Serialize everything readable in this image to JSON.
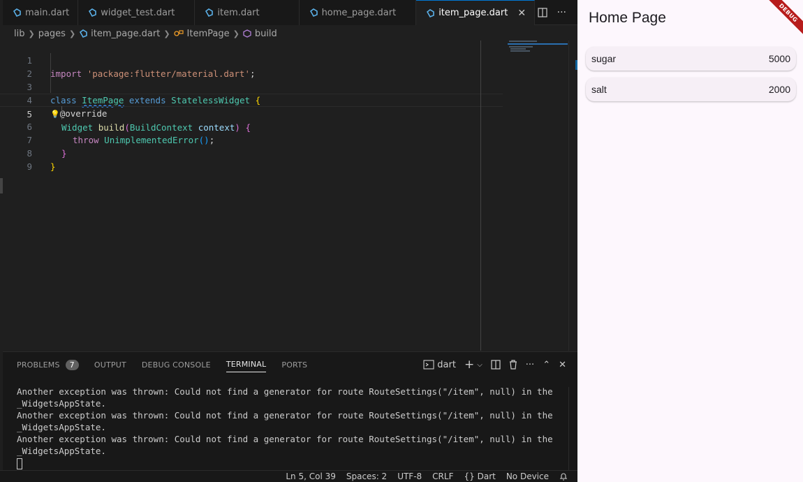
{
  "tabs": [
    {
      "label": "main.dart"
    },
    {
      "label": "widget_test.dart"
    },
    {
      "label": "item.dart"
    },
    {
      "label": "home_page.dart"
    },
    {
      "label": "item_page.dart",
      "active": true
    }
  ],
  "breadcrumb": [
    "lib",
    "pages",
    "item_page.dart",
    "ItemPage",
    "build"
  ],
  "code": {
    "line_numbers": [
      "1",
      "2",
      "3",
      "4",
      "5",
      "6",
      "7",
      "8",
      "9"
    ],
    "l1": {
      "kw": "import",
      "str": "'package:flutter/material.dart'",
      "end": ";"
    },
    "l3": {
      "kw": "class",
      "name": "ItemPage",
      "kw2": "extends",
      "base": "StatelessWidget",
      "brace": "{"
    },
    "l4": {
      "bulb": "💡",
      "annotation": "@override"
    },
    "l5": {
      "type": "Widget",
      "fn": "build",
      "open": "(",
      "ptype": "BuildContext",
      "pname": "context",
      "close": ")",
      "brace": "{"
    },
    "l6": {
      "kw": "throw",
      "cls": "UnimplementedError",
      "call": "()",
      "end": ";"
    },
    "l7": {
      "brace": "}"
    },
    "l8": {
      "brace": "}"
    }
  },
  "panel": {
    "tabs": [
      "PROBLEMS",
      "OUTPUT",
      "DEBUG CONSOLE",
      "TERMINAL",
      "PORTS"
    ],
    "problems_count": "7",
    "terminal_name": "dart",
    "lines": [
      "Another exception was thrown: Could not find a generator for route RouteSettings(\"/item\", null) in the",
      "_WidgetsAppState.",
      "Another exception was thrown: Could not find a generator for route RouteSettings(\"/item\", null) in the",
      "_WidgetsAppState.",
      "Another exception was thrown: Could not find a generator for route RouteSettings(\"/item\", null) in the",
      "_WidgetsAppState."
    ]
  },
  "status": {
    "position": "Ln 5, Col 39",
    "spaces": "Spaces: 2",
    "encoding": "UTF-8",
    "eol": "CRLF",
    "language": "Dart",
    "device": "No Device"
  },
  "app": {
    "title": "Home Page",
    "items": [
      {
        "name": "sugar",
        "value": "5000"
      },
      {
        "name": "salt",
        "value": "2000"
      }
    ],
    "banner": "DEBUG"
  },
  "colors": {
    "accent": "#0078d4",
    "app_bg": "#fdf7fd",
    "banner": "#b71c1c"
  }
}
